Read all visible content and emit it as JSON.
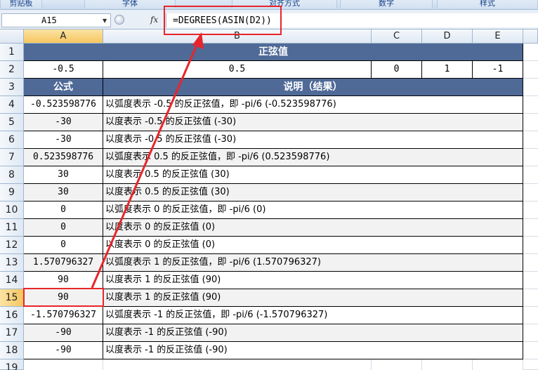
{
  "ribbon": {
    "groups": [
      "剪贴板",
      "字体",
      "对齐方式",
      "数字",
      "样式"
    ]
  },
  "formula_bar": {
    "name_box": "A15",
    "fx_label": "fx",
    "formula": "=DEGREES(ASIN(D2))"
  },
  "columns": [
    "A",
    "B",
    "C",
    "D",
    "E"
  ],
  "rows": [
    "1",
    "2",
    "3",
    "4",
    "5",
    "6",
    "7",
    "8",
    "9",
    "10",
    "11",
    "12",
    "13",
    "14",
    "15",
    "16",
    "17",
    "18",
    "19"
  ],
  "sheet": {
    "title": "正弦值",
    "input_row": [
      "-0.5",
      "0.5",
      "0",
      "1",
      "-1"
    ],
    "header": [
      "公式",
      "说明（结果）"
    ],
    "data": [
      [
        "-0.523598776",
        "以弧度表示 -0.5 的反正弦值，即 -pi/6 (-0.523598776)"
      ],
      [
        "-30",
        "以度表示 -0.5 的反正弦值 (-30)"
      ],
      [
        "-30",
        "以度表示 -0.5 的反正弦值 (-30)"
      ],
      [
        "0.523598776",
        "以弧度表示 0.5 的反正弦值，即 -pi/6 (0.523598776)"
      ],
      [
        "30",
        "以度表示 0.5 的反正弦值 (30)"
      ],
      [
        "30",
        "以度表示 0.5 的反正弦值 (30)"
      ],
      [
        "0",
        "以弧度表示 0 的反正弦值，即 -pi/6 (0)"
      ],
      [
        "0",
        "以度表示 0 的反正弦值 (0)"
      ],
      [
        "0",
        "以度表示 0 的反正弦值 (0)"
      ],
      [
        "1.570796327",
        "以弧度表示 1 的反正弦值，即 -pi/6 (1.570796327)"
      ],
      [
        "90",
        "以度表示 1 的反正弦值 (90)"
      ],
      [
        "90",
        "以度表示 1 的反正弦值 (90)"
      ],
      [
        "-1.570796327",
        "以弧度表示 -1 的反正弦值，即 -pi/6 (-1.570796327)"
      ],
      [
        "-90",
        "以度表示 -1 的反正弦值 (-90)"
      ],
      [
        "-90",
        "以度表示 -1 的反正弦值 (-90)"
      ]
    ]
  },
  "colors": {
    "header_fill": "#4f6a97",
    "highlight": "#e8252b"
  }
}
